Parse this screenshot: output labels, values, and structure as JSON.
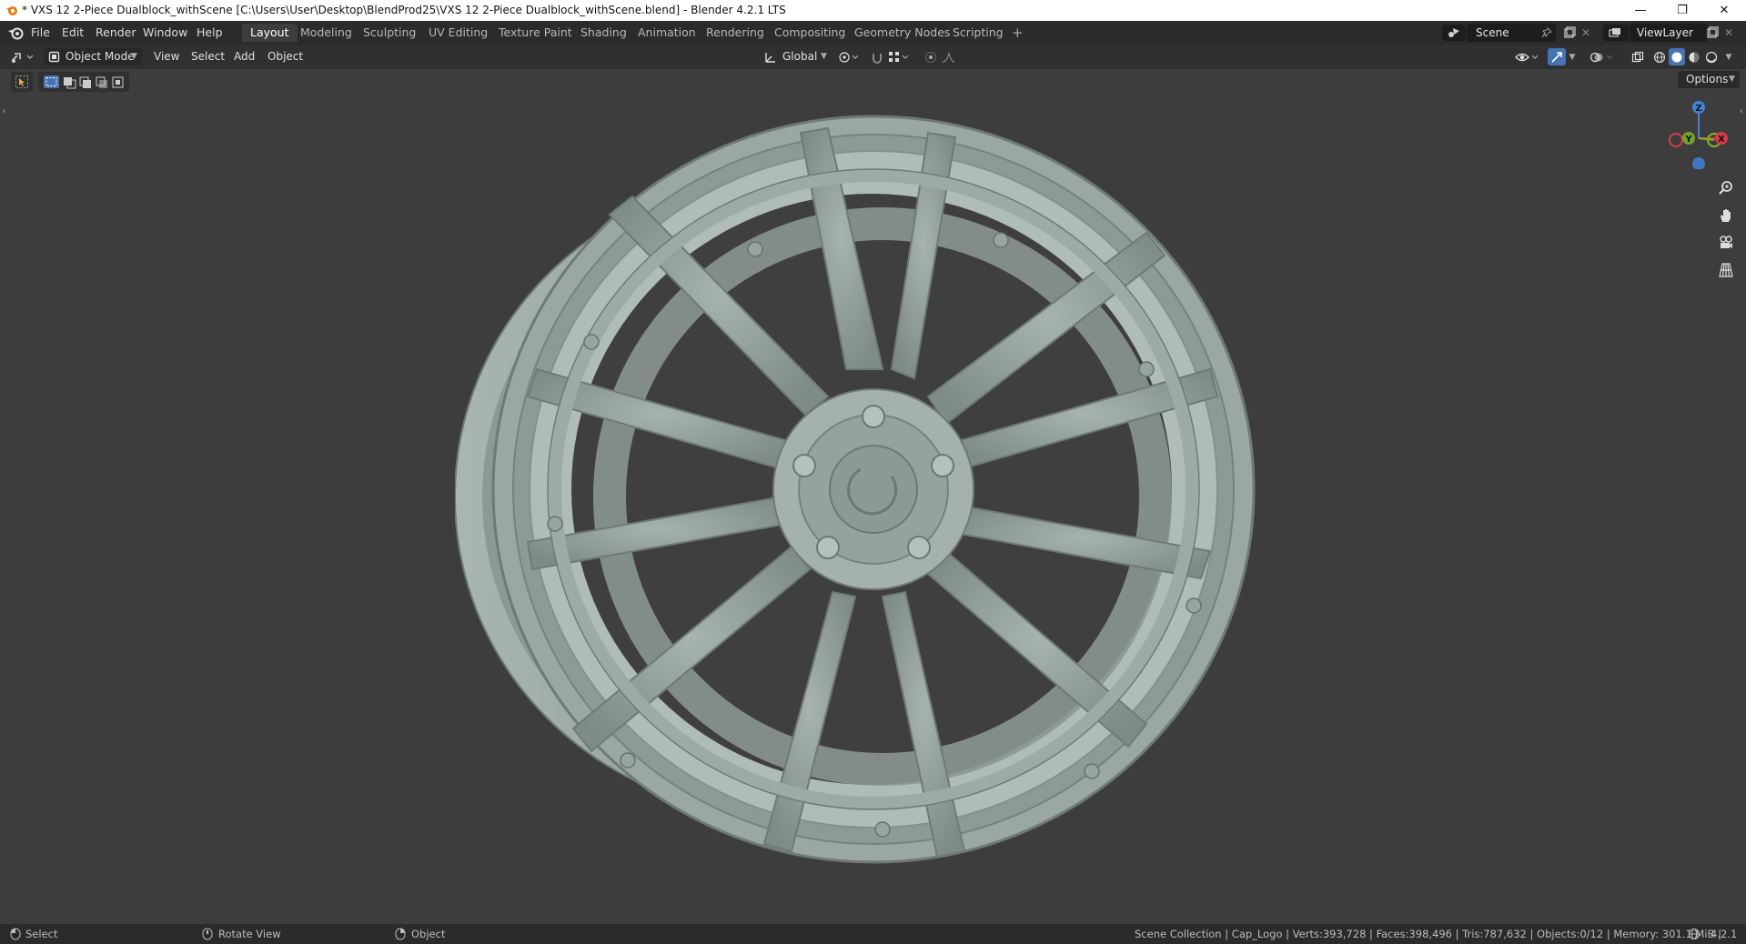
{
  "window": {
    "title": "* VXS 12 2-Piece Dualblock_withScene [C:\\Users\\User\\Desktop\\BlendProd25\\VXS 12 2-Piece Dualblock_withScene.blend] - Blender 4.2.1 LTS",
    "minimize": "—",
    "maximize": "❐",
    "close": "✕"
  },
  "menus": [
    "File",
    "Edit",
    "Render",
    "Window",
    "Help"
  ],
  "workspaces": [
    "Layout",
    "Modeling",
    "Sculpting",
    "UV Editing",
    "Texture Paint",
    "Shading",
    "Animation",
    "Rendering",
    "Compositing",
    "Geometry Nodes",
    "Scripting"
  ],
  "add_workspace": "+",
  "scene": {
    "label": "Scene"
  },
  "view_layer": {
    "label": "ViewLayer"
  },
  "viewport_header": {
    "mode": "Object Mode",
    "menus": [
      "View",
      "Select",
      "Add",
      "Object"
    ],
    "orientation": "Global",
    "options": "Options"
  },
  "gizmo": {
    "z": "Z",
    "y": "Y",
    "x": "X"
  },
  "status": {
    "select": "Select",
    "rotate": "Rotate View",
    "object": "Object",
    "stats": "Scene Collection | Cap_Logo | Verts:393,728 | Faces:398,496 | Tris:787,632 | Objects:0/12 | Memory: 301.1 MiB |",
    "version": "4.2.1"
  },
  "colors": {
    "accent": "#4772b3",
    "gizmo_x": "#d83a4a",
    "gizmo_y": "#7fb42b",
    "gizmo_z": "#3f82d8",
    "wheel": "#9aa6a1"
  }
}
